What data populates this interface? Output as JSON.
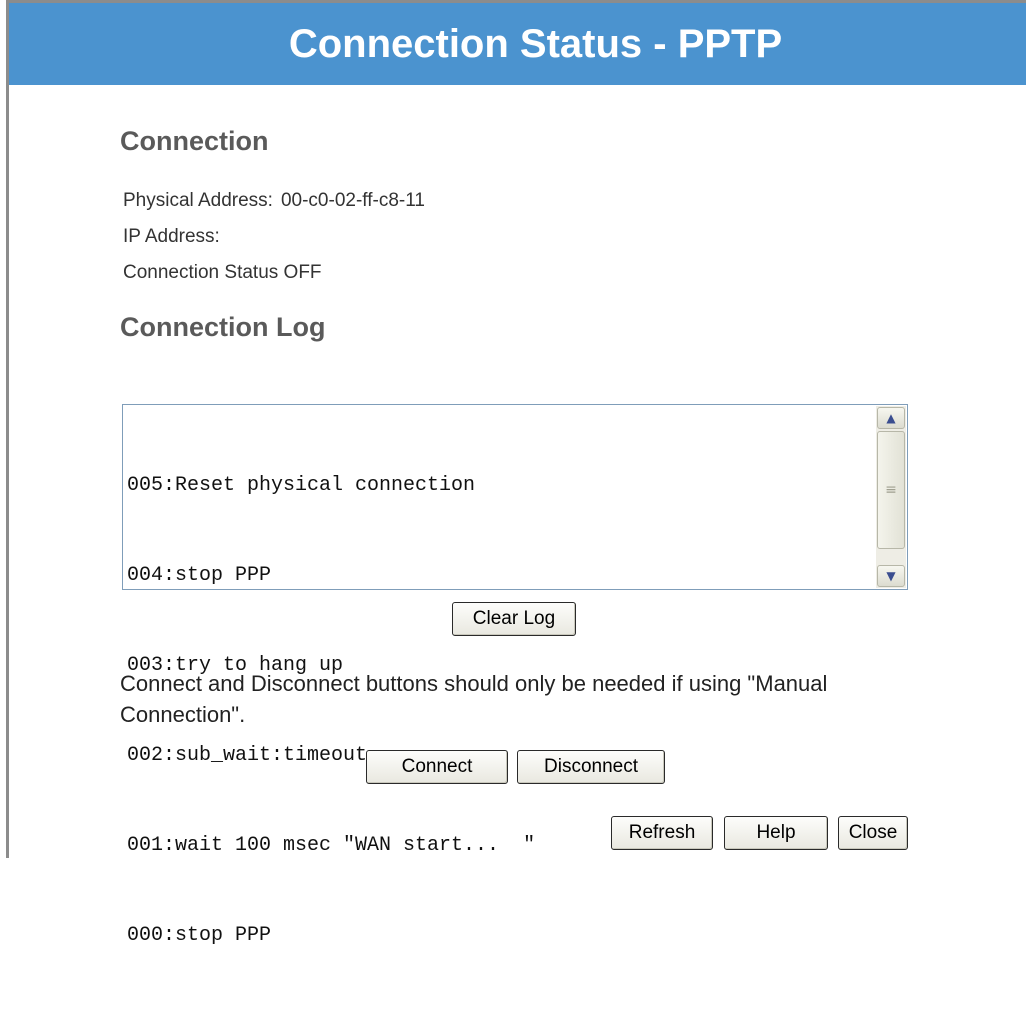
{
  "header": {
    "title": "Connection Status - PPTP"
  },
  "connection": {
    "heading": "Connection",
    "physical_address_label": "Physical Address:",
    "physical_address_value": "00-c0-02-ff-c8-11",
    "ip_address_label": "IP Address:",
    "ip_address_value": "",
    "status_label": "Connection Status",
    "status_value": "OFF"
  },
  "log": {
    "heading": "Connection Log",
    "lines": [
      "005:Reset physical connection",
      "004:stop PPP",
      "003:try to hang up",
      "002:sub_wait:timeout",
      "001:wait 100 msec \"WAN start...  \"",
      "000:stop PPP"
    ],
    "clear_label": "Clear Log"
  },
  "note": "Connect and Disconnect buttons should only be needed if using \"Manual Connection\".",
  "actions": {
    "connect_label": "Connect",
    "disconnect_label": "Disconnect"
  },
  "footer": {
    "refresh_label": "Refresh",
    "help_label": "Help",
    "close_label": "Close"
  },
  "colors": {
    "titlebar": "#4b93cf",
    "heading_text": "#5a5a5a"
  }
}
